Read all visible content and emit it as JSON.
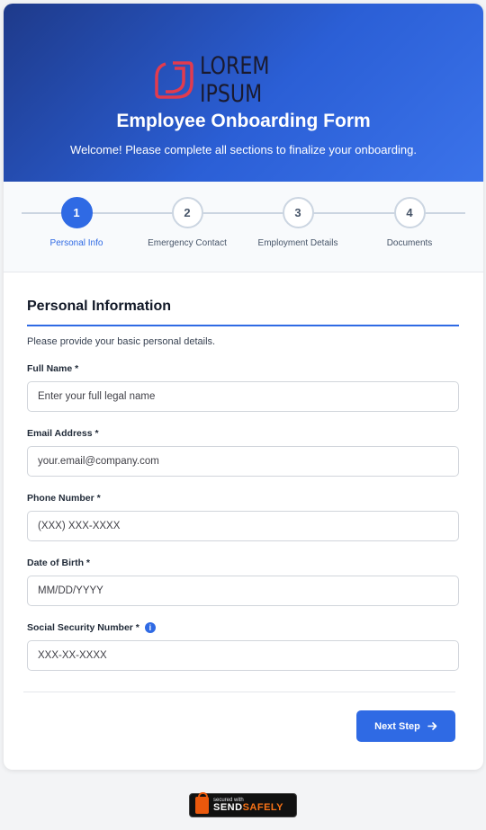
{
  "header": {
    "logo_text": "LOREM IPSUM",
    "title": "Employee Onboarding Form",
    "subtitle": "Welcome! Please complete all sections to finalize your onboarding."
  },
  "steps": [
    {
      "number": "1",
      "label": "Personal Info",
      "active": true
    },
    {
      "number": "2",
      "label": "Emergency Contact",
      "active": false
    },
    {
      "number": "3",
      "label": "Employment Details",
      "active": false
    },
    {
      "number": "4",
      "label": "Documents",
      "active": false
    }
  ],
  "section": {
    "title": "Personal Information",
    "description": "Please provide your basic personal details."
  },
  "fields": [
    {
      "label": "Full Name *",
      "placeholder": "Enter your full legal name"
    },
    {
      "label": "Email Address *",
      "placeholder": "your.email@company.com"
    },
    {
      "label": "Phone Number *",
      "placeholder": "(XXX) XXX-XXXX"
    },
    {
      "label": "Date of Birth *",
      "placeholder": "MM/DD/YYYY"
    },
    {
      "label": "Social Security Number *",
      "placeholder": "XXX-XX-XXXX",
      "info_icon": "i"
    }
  ],
  "actions": {
    "next_label": "Next Step",
    "next_icon": "arrow-right-icon"
  },
  "footer_badge": {
    "small_text": "secured with",
    "brand_part1": "SEND",
    "brand_part2": "SAFELY"
  },
  "colors": {
    "accent": "#2f6ae4",
    "header_start": "#1e3a8a",
    "header_end": "#3b73ea",
    "logo_red": "#e23b4e"
  }
}
